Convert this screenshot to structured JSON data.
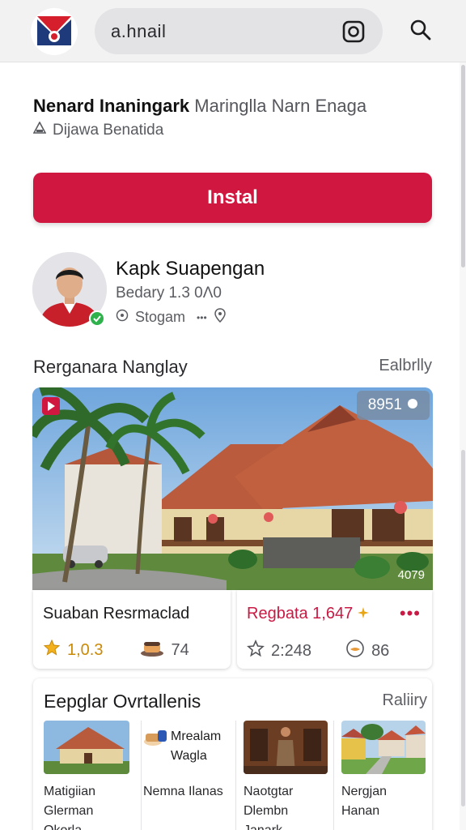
{
  "topbar": {
    "search_value": "a.hnail",
    "icons": [
      "logo",
      "camera-icon",
      "search-icon"
    ]
  },
  "app": {
    "title": "Nenard Inaningark",
    "title_sub": "Maringlla Narn Enaga",
    "developer": "Dijawa Benatida",
    "install_label": "Instal",
    "accent": "#d0173f"
  },
  "profile": {
    "name": "Kapk Suapengan",
    "meta": "Bedary 1.3 0Λ0",
    "tag": "Stogam",
    "more": "•••"
  },
  "section": {
    "title": "Rerganara Nanglay",
    "link": "Ealbrlly"
  },
  "hero": {
    "badge": "8951",
    "count": "4079"
  },
  "cards": [
    {
      "title": "Suaban Resrmaclad",
      "stat1": "1,0.3",
      "stat2": "74"
    },
    {
      "title": "Regbata 1,647",
      "stat1": "2:248",
      "stat2": "86",
      "more": "•••"
    }
  ],
  "popular": {
    "title": "Eepglar Ovrtallenis",
    "link": "Raliiry",
    "items": [
      {
        "label": "Matigiian Glerman Okorla"
      },
      {
        "label": "Mrealam Wagla",
        "caption": "Nemna Ilanas"
      },
      {
        "label": "Naotgtar Dlembn Janark"
      },
      {
        "label": "Nergjan Hanan"
      }
    ]
  }
}
